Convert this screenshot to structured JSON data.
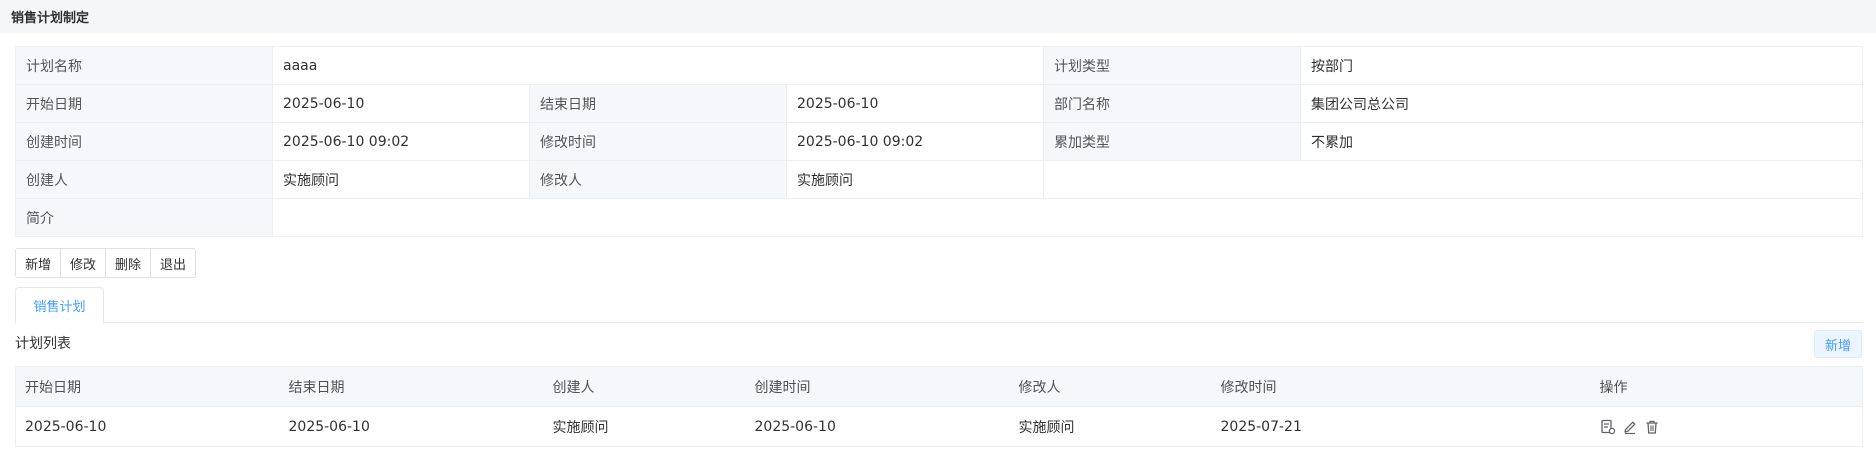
{
  "page": {
    "title": "销售计划制定"
  },
  "info": {
    "plan_name_label": "计划名称",
    "plan_name_value": "aaaa",
    "plan_type_label": "计划类型",
    "plan_type_value": "按部门",
    "start_date_label": "开始日期",
    "start_date_value": "2025-06-10",
    "end_date_label": "结束日期",
    "end_date_value": "2025-06-10",
    "dept_name_label": "部门名称",
    "dept_name_value": "集团公司总公司",
    "created_time_label": "创建时间",
    "created_time_value": "2025-06-10 09:02",
    "modified_time_label": "修改时间",
    "modified_time_value": "2025-06-10 09:02",
    "accum_type_label": "累加类型",
    "accum_type_value": "不累加",
    "creator_label": "创建人",
    "creator_value": "实施顾问",
    "modifier_label": "修改人",
    "modifier_value": "实施顾问",
    "summary_label": "简介",
    "summary_value": ""
  },
  "toolbar": {
    "new_label": "新增",
    "edit_label": "修改",
    "delete_label": "删除",
    "exit_label": "退出"
  },
  "tabs": {
    "active_label": "销售计划"
  },
  "list": {
    "title": "计划列表",
    "add_label": "新增",
    "columns": [
      "开始日期",
      "结束日期",
      "创建人",
      "创建时间",
      "修改人",
      "修改时间",
      "操作"
    ],
    "rows": [
      {
        "start": "2025-06-10",
        "end": "2025-06-10",
        "creator": "实施顾问",
        "created": "2025-06-10",
        "modifier": "实施顾问",
        "modified": "2025-07-21"
      }
    ],
    "row_icons": [
      "detail-icon",
      "edit-icon",
      "delete-icon"
    ]
  },
  "colors": {
    "accent": "#409eff",
    "label_bg": "#f5f7fa",
    "border": "#ebeef5"
  }
}
